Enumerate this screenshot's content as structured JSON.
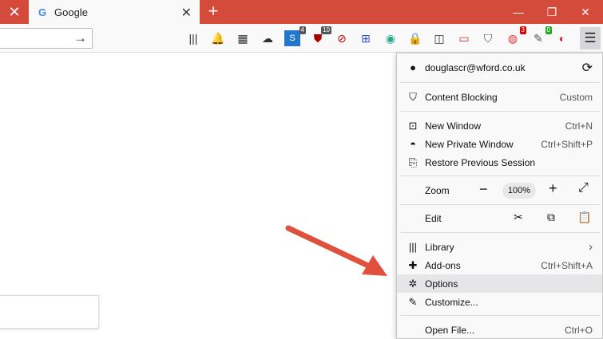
{
  "tab": {
    "title": "Google",
    "favicon": "G"
  },
  "window": {
    "accent": "#d44b3c"
  },
  "toolbar": {
    "badges": [
      "4",
      "10",
      "3",
      "0"
    ]
  },
  "menu": {
    "account": "douglascr@wford.co.uk",
    "content_blocking": {
      "label": "Content Blocking",
      "value": "Custom"
    },
    "new_window": {
      "label": "New Window",
      "shortcut": "Ctrl+N"
    },
    "new_private_window": {
      "label": "New Private Window",
      "shortcut": "Ctrl+Shift+P"
    },
    "restore_session": {
      "label": "Restore Previous Session"
    },
    "zoom": {
      "label": "Zoom",
      "minus": "−",
      "value": "100%",
      "plus": "+"
    },
    "edit": {
      "label": "Edit"
    },
    "library": {
      "label": "Library",
      "chevron": "›"
    },
    "addons": {
      "label": "Add-ons",
      "shortcut": "Ctrl+Shift+A"
    },
    "options": {
      "label": "Options"
    },
    "customize": {
      "label": "Customize..."
    },
    "open_file": {
      "label": "Open File...",
      "shortcut": "Ctrl+O"
    }
  }
}
